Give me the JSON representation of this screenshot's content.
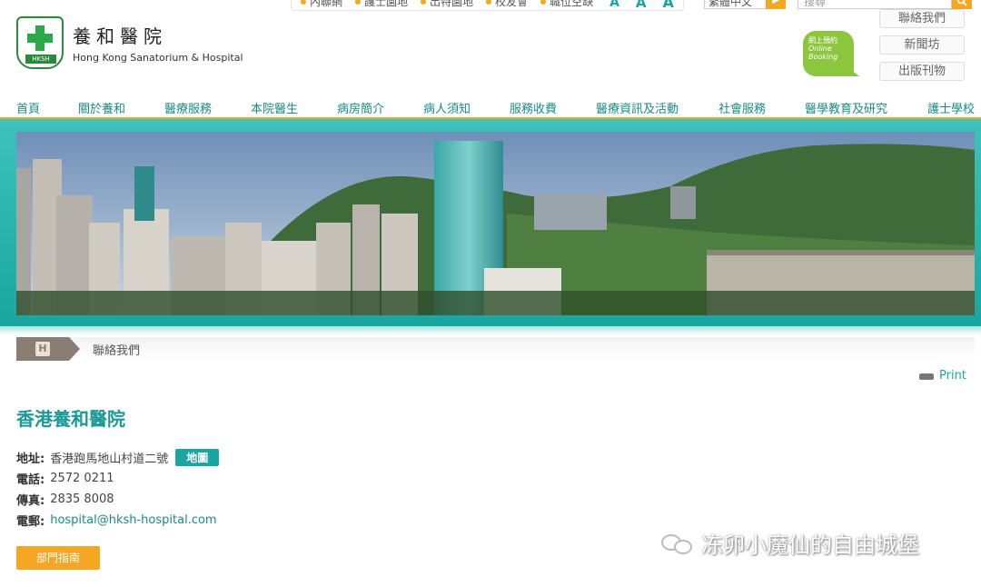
{
  "topbar": {
    "links": [
      "內聯網",
      "護士園地",
      "出特園地",
      "校友會",
      "職位空缺"
    ],
    "font_sizes": [
      "A",
      "A",
      "A"
    ],
    "language": "繁體中文",
    "search_placeholder": "搜尋"
  },
  "header": {
    "logo_tag": "HKSH",
    "name_zh": "養和醫院",
    "name_en": "Hong Kong Sanatorium & Hospital",
    "booking_line1": "網上預約",
    "booking_line2": "Online",
    "booking_line3": "Booking",
    "side_buttons": [
      "聯絡我們",
      "新聞坊",
      "出版刊物"
    ]
  },
  "nav": {
    "items": [
      "首頁",
      "關於養和",
      "醫療服務",
      "本院醫生",
      "病房簡介",
      "病人須知",
      "服務收費",
      "醫療資訊及活動",
      "社會服務",
      "醫學教育及研究",
      "護士學校"
    ]
  },
  "breadcrumb": {
    "home_icon": "H",
    "current": "聯絡我們"
  },
  "print_label": "Print",
  "content": {
    "title": "香港養和醫院",
    "address_label": "地址:",
    "address_value": "香港跑馬地山村道二號",
    "map_button": "地圖",
    "phone_label": "電話:",
    "phone_value": "2572 0211",
    "fax_label": "傳真:",
    "fax_value": "2835 8008",
    "email_label": "電郵:",
    "email_value": "hospital@hksh-hospital.com",
    "dept_button": "部門指南"
  },
  "watermark": "冻卵小魔仙的自由城堡",
  "colors": {
    "accent_teal": "#1aa6a0",
    "accent_orange": "#f5a623",
    "booking_green": "#8cc63f"
  }
}
